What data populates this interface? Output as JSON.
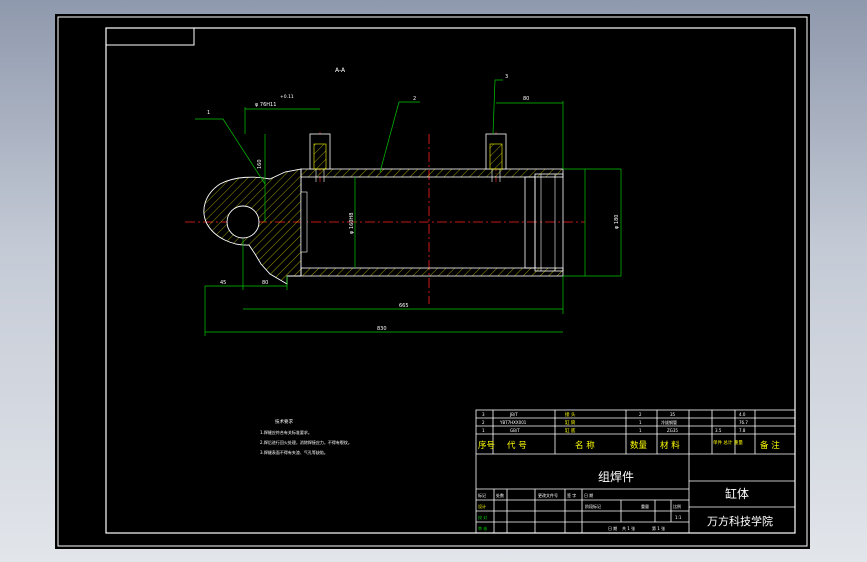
{
  "drawing": {
    "section_label": "A-A",
    "leaders": [
      "1",
      "2",
      "3"
    ],
    "dimensions": {
      "top_tol": "+0.11",
      "top_tol2": "0",
      "top_dia": "φ 76H11",
      "right_top": "80",
      "left_vert": "160",
      "bore": "φ 160H8",
      "outer": "φ 180",
      "d1": "45",
      "d2": "80",
      "d3": "665",
      "d4": "830"
    },
    "colors": {
      "outline": "#ffffff",
      "dimension": "#00c800",
      "centerline": "#ff2020",
      "detail": "#ffff00"
    }
  },
  "notes": {
    "title": "技术要求",
    "lines": [
      "1.焊缝应符合有关标准要求。",
      "2.焊后进行回火处理，消除焊接应力，不得有裂纹。",
      "3.焊缝表面不得有夹渣、气孔等缺陷。"
    ]
  },
  "bom": {
    "rows": [
      {
        "no": "3",
        "code": "JB/T",
        "name": "接 头",
        "qty": "2",
        "mat": "35"
      },
      {
        "no": "2",
        "code": "YBT7HXX001",
        "name": "缸 筒",
        "qty": "1",
        "mat": "冷拔钢管"
      },
      {
        "no": "1",
        "code": "GB/T",
        "name": "缸 底",
        "qty": "1",
        "mat": "ZG35"
      }
    ],
    "right_cells": [
      "4.0",
      "76.7",
      "3.5",
      "7.8"
    ],
    "header": [
      "序号",
      "代 号",
      "名 称",
      "数量",
      "材 料",
      "单件 总计 重量",
      "备 注"
    ]
  },
  "title_block": {
    "assembly": "组焊件",
    "part_name": "缸体",
    "school": "万方科技学院",
    "labels": [
      "标记",
      "处数",
      "更改文件号",
      "签 字",
      "日 期",
      "设计",
      "校 对",
      "审 核",
      "工 艺",
      "日 期",
      "共 1 张",
      "第 1 张",
      "阶段标记",
      "重量",
      "比例"
    ],
    "values": [
      "1:1"
    ]
  }
}
